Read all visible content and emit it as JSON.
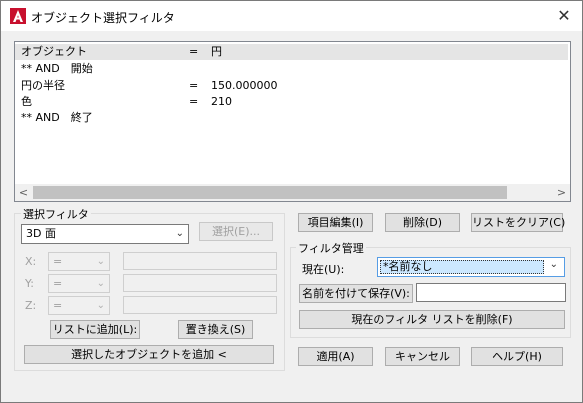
{
  "window": {
    "title": "オブジェクト選択フィルタ",
    "close_glyph": "✕"
  },
  "filter_list": {
    "rows": [
      {
        "name": "オブジェクト",
        "op": "=",
        "value": "円"
      },
      {
        "name": "** AND　開始",
        "op": "",
        "value": ""
      },
      {
        "name": "円の半径",
        "op": "=",
        "value": "150.000000"
      },
      {
        "name": "色",
        "op": "=",
        "value": "210"
      },
      {
        "name": "** AND　終了",
        "op": "",
        "value": ""
      }
    ],
    "scroll_left": "<",
    "scroll_right": ">"
  },
  "select_filter": {
    "group_label": "選択フィルタ",
    "object_type": "3D 面",
    "select_button": "選択(E)...",
    "x_label": "X:",
    "y_label": "Y:",
    "z_label": "Z:",
    "x_op": "=",
    "y_op": "=",
    "z_op": "=",
    "add_to_list_button": "リストに追加(L):",
    "replace_button": "置き換え(S)",
    "add_selected_button": "選択したオブジェクトを追加 <"
  },
  "list_buttons": {
    "edit_item": "項目編集(I)",
    "delete": "削除(D)",
    "clear_list": "リストをクリア(C)"
  },
  "filter_management": {
    "group_label": "フィルタ管理",
    "current_label": "現在(U):",
    "current_value": "*名前なし",
    "save_as_button": "名前を付けて保存(V):",
    "save_as_value": "",
    "delete_current_button": "現在のフィルタ リストを削除(F)"
  },
  "dialog_buttons": {
    "apply": "適用(A)",
    "cancel": "キャンセル",
    "help": "ヘルプ(H)"
  }
}
